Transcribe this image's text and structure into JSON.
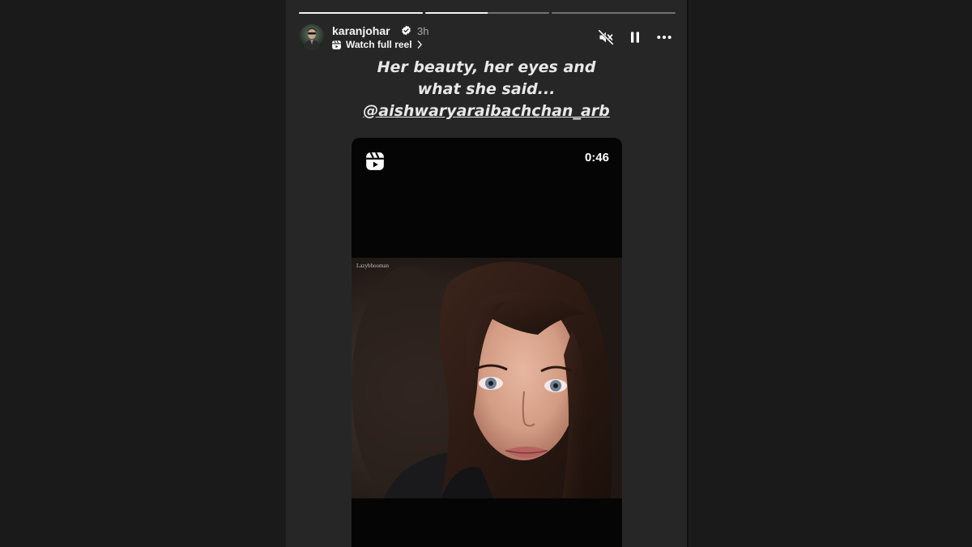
{
  "story": {
    "username": "karanjohar",
    "time_ago": "3h",
    "watch_full_reel": "Watch full reel",
    "progress": [
      1.0,
      0.5,
      0.0
    ],
    "caption_line1": "Her beauty, her eyes and",
    "caption_line2": "what she said...",
    "caption_mention": "@aishwaryaraibachchan_arb"
  },
  "reel": {
    "duration": "0:46",
    "watermark": "Lazybhooman"
  },
  "colors": {
    "page_background": "#1a1a1a",
    "story_background": "#262626",
    "reel_background": "#050505",
    "verified_badge": "#ffffff"
  },
  "icons": {
    "verified": "verified-badge-icon",
    "reel": "reels-icon",
    "mute": "speaker-muted-icon",
    "pause": "pause-icon",
    "more": "more-horizontal-icon",
    "chevron": "chevron-right-icon"
  }
}
